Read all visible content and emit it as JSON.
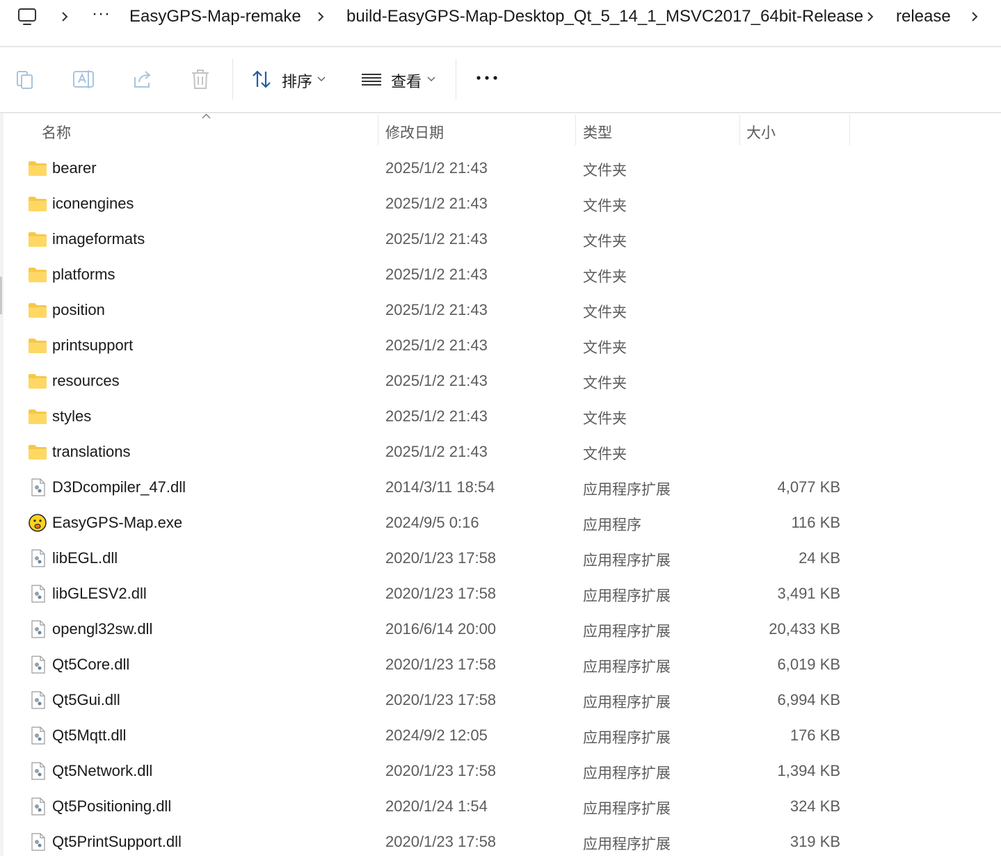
{
  "address_bar": {
    "ellipsis": "···",
    "crumbs": [
      "EasyGPS-Map-remake",
      "build-EasyGPS-Map-Desktop_Qt_5_14_1_MSVC2017_64bit-Release",
      "release"
    ]
  },
  "toolbar": {
    "sort_label": "排序",
    "view_label": "查看",
    "icons": [
      "copy-icon",
      "rename-icon",
      "share-icon",
      "delete-icon",
      "sort-icon",
      "view-icon",
      "more-icon"
    ]
  },
  "columns": {
    "name": "名称",
    "modified": "修改日期",
    "type": "类型",
    "size": "大小"
  },
  "files": [
    {
      "icon": "folder-icon",
      "name": "bearer",
      "modified": "2025/1/2 21:43",
      "type": "文件夹",
      "size": ""
    },
    {
      "icon": "folder-icon",
      "name": "iconengines",
      "modified": "2025/1/2 21:43",
      "type": "文件夹",
      "size": ""
    },
    {
      "icon": "folder-icon",
      "name": "imageformats",
      "modified": "2025/1/2 21:43",
      "type": "文件夹",
      "size": ""
    },
    {
      "icon": "folder-icon",
      "name": "platforms",
      "modified": "2025/1/2 21:43",
      "type": "文件夹",
      "size": ""
    },
    {
      "icon": "folder-icon",
      "name": "position",
      "modified": "2025/1/2 21:43",
      "type": "文件夹",
      "size": ""
    },
    {
      "icon": "folder-icon",
      "name": "printsupport",
      "modified": "2025/1/2 21:43",
      "type": "文件夹",
      "size": ""
    },
    {
      "icon": "folder-icon",
      "name": "resources",
      "modified": "2025/1/2 21:43",
      "type": "文件夹",
      "size": ""
    },
    {
      "icon": "folder-icon",
      "name": "styles",
      "modified": "2025/1/2 21:43",
      "type": "文件夹",
      "size": ""
    },
    {
      "icon": "folder-icon",
      "name": "translations",
      "modified": "2025/1/2 21:43",
      "type": "文件夹",
      "size": ""
    },
    {
      "icon": "dll-icon",
      "name": "D3Dcompiler_47.dll",
      "modified": "2014/3/11 18:54",
      "type": "应用程序扩展",
      "size": "4,077 KB"
    },
    {
      "icon": "app-icon",
      "name": "EasyGPS-Map.exe",
      "modified": "2024/9/5 0:16",
      "type": "应用程序",
      "size": "116 KB"
    },
    {
      "icon": "dll-icon",
      "name": "libEGL.dll",
      "modified": "2020/1/23 17:58",
      "type": "应用程序扩展",
      "size": "24 KB"
    },
    {
      "icon": "dll-icon",
      "name": "libGLESV2.dll",
      "modified": "2020/1/23 17:58",
      "type": "应用程序扩展",
      "size": "3,491 KB"
    },
    {
      "icon": "dll-icon",
      "name": "opengl32sw.dll",
      "modified": "2016/6/14 20:00",
      "type": "应用程序扩展",
      "size": "20,433 KB"
    },
    {
      "icon": "dll-icon",
      "name": "Qt5Core.dll",
      "modified": "2020/1/23 17:58",
      "type": "应用程序扩展",
      "size": "6,019 KB"
    },
    {
      "icon": "dll-icon",
      "name": "Qt5Gui.dll",
      "modified": "2020/1/23 17:58",
      "type": "应用程序扩展",
      "size": "6,994 KB"
    },
    {
      "icon": "dll-icon",
      "name": "Qt5Mqtt.dll",
      "modified": "2024/9/2 12:05",
      "type": "应用程序扩展",
      "size": "176 KB"
    },
    {
      "icon": "dll-icon",
      "name": "Qt5Network.dll",
      "modified": "2020/1/23 17:58",
      "type": "应用程序扩展",
      "size": "1,394 KB"
    },
    {
      "icon": "dll-icon",
      "name": "Qt5Positioning.dll",
      "modified": "2020/1/24 1:54",
      "type": "应用程序扩展",
      "size": "324 KB"
    },
    {
      "icon": "dll-icon",
      "name": "Qt5PrintSupport.dll",
      "modified": "2020/1/23 17:58",
      "type": "应用程序扩展",
      "size": "319 KB"
    }
  ]
}
